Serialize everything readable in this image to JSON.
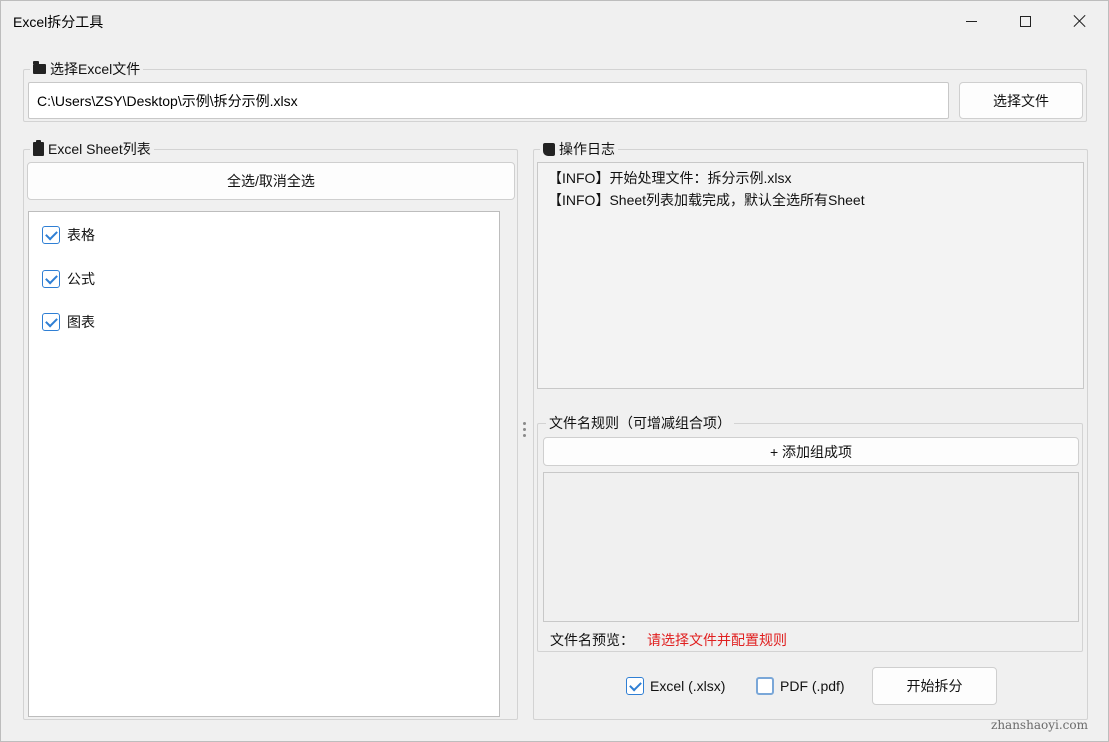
{
  "window": {
    "title": "Excel拆分工具"
  },
  "file_group": {
    "title": "选择Excel文件",
    "icon": "folder-icon",
    "path_value": "C:\\Users\\ZSY\\Desktop\\示例\\拆分示例.xlsx",
    "choose_button": "选择文件"
  },
  "sheet_group": {
    "title": "Excel Sheet列表",
    "icon": "clipboard-icon",
    "select_all_button": "全选/取消全选",
    "items": [
      {
        "label": "表格",
        "checked": true
      },
      {
        "label": "公式",
        "checked": true
      },
      {
        "label": "图表",
        "checked": true
      }
    ]
  },
  "log_group": {
    "title": "操作日志",
    "icon": "scroll-icon",
    "lines": [
      "【INFO】开始处理文件：拆分示例.xlsx",
      "【INFO】Sheet列表加载完成，默认全选所有Sheet"
    ]
  },
  "rule_group": {
    "title": "文件名规则（可增减组合项）",
    "add_button": "+ 添加组成项",
    "preview_label": "文件名预览：",
    "preview_value": "请选择文件并配置规则"
  },
  "output": {
    "formats": [
      {
        "label": "Excel (.xlsx)",
        "checked": true
      },
      {
        "label": "PDF (.pdf)",
        "checked": false
      }
    ],
    "start_button": "开始拆分"
  },
  "watermark": "zhanshaoyi.com",
  "colors": {
    "accent": "#2f7fd4",
    "warning_text": "#e02020"
  }
}
